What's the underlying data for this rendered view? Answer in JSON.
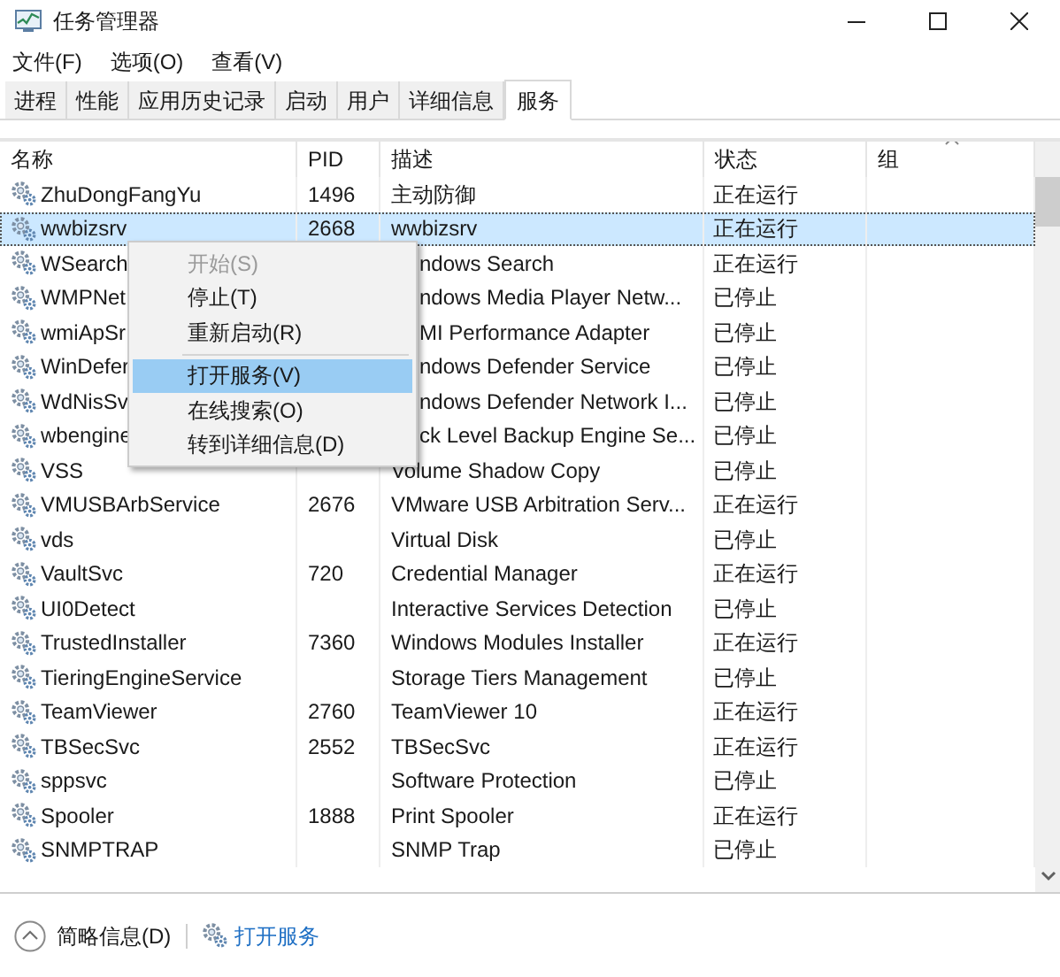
{
  "window": {
    "title": "任务管理器"
  },
  "menu_bar": [
    "文件(F)",
    "选项(O)",
    "查看(V)"
  ],
  "tabs": [
    {
      "label": "进程",
      "selected": false
    },
    {
      "label": "性能",
      "selected": false
    },
    {
      "label": "应用历史记录",
      "selected": false
    },
    {
      "label": "启动",
      "selected": false
    },
    {
      "label": "用户",
      "selected": false
    },
    {
      "label": "详细信息",
      "selected": false
    },
    {
      "label": "服务",
      "selected": true
    }
  ],
  "table": {
    "columns": [
      "名称",
      "PID",
      "描述",
      "状态",
      "组"
    ],
    "rows": [
      {
        "name": "ZhuDongFangYu",
        "pid": "1496",
        "description": "主动防御",
        "status": "正在运行",
        "selected": false
      },
      {
        "name": "wwbizsrv",
        "pid": "2668",
        "description": "wwbizsrv",
        "status": "正在运行",
        "selected": true
      },
      {
        "name": "WSearch",
        "description": "ndows Search",
        "status": "正在运行",
        "selected": false
      },
      {
        "name": "WMPNet",
        "description": "ndows Media Player Netw...",
        "status": "已停止",
        "selected": false
      },
      {
        "name": "wmiApSr",
        "description": "MI Performance Adapter",
        "status": "已停止",
        "selected": false
      },
      {
        "name": "WinDefer",
        "description": "ndows Defender Service",
        "status": "已停止",
        "selected": false
      },
      {
        "name": "WdNisSv",
        "description": "ndows Defender Network I...",
        "status": "已停止",
        "selected": false
      },
      {
        "name": "wbengine",
        "description": "ck Level Backup Engine Se...",
        "status": "已停止",
        "selected": false
      },
      {
        "name": "VSS",
        "description": "Volume Shadow Copy",
        "status": "已停止",
        "selected": false
      },
      {
        "name": "VMUSBArbService",
        "pid": "2676",
        "description": "VMware USB Arbitration Serv...",
        "status": "正在运行",
        "selected": false
      },
      {
        "name": "vds",
        "description": "Virtual Disk",
        "status": "已停止",
        "selected": false
      },
      {
        "name": "VaultSvc",
        "pid": "720",
        "description": "Credential Manager",
        "status": "正在运行",
        "selected": false
      },
      {
        "name": "UI0Detect",
        "description": "Interactive Services Detection",
        "status": "已停止",
        "selected": false
      },
      {
        "name": "TrustedInstaller",
        "pid": "7360",
        "description": "Windows Modules Installer",
        "status": "正在运行",
        "selected": false
      },
      {
        "name": "TieringEngineService",
        "description": "Storage Tiers Management",
        "status": "已停止",
        "selected": false
      },
      {
        "name": "TeamViewer",
        "pid": "2760",
        "description": "TeamViewer 10",
        "status": "正在运行",
        "selected": false
      },
      {
        "name": "TBSecSvc",
        "pid": "2552",
        "description": "TBSecSvc",
        "status": "正在运行",
        "selected": false
      },
      {
        "name": "sppsvc",
        "description": "Software Protection",
        "status": "已停止",
        "selected": false
      },
      {
        "name": "Spooler",
        "pid": "1888",
        "description": "Print Spooler",
        "status": "正在运行",
        "selected": false
      },
      {
        "name": "SNMPTRAP",
        "description": "SNMP Trap",
        "status": "已停止",
        "selected": false
      }
    ]
  },
  "context_menu": {
    "items": [
      {
        "label": "开始(S)",
        "disabled": true,
        "selected": false
      },
      {
        "label": "停止(T)",
        "disabled": false,
        "selected": false
      },
      {
        "label": "重新启动(R)",
        "disabled": false,
        "selected": false,
        "separator_after": true
      },
      {
        "label": "打开服务(V)",
        "disabled": false,
        "selected": true
      },
      {
        "label": "在线搜索(O)",
        "disabled": false,
        "selected": false
      },
      {
        "label": "转到详细信息(D)",
        "disabled": false,
        "selected": false
      }
    ]
  },
  "footer": {
    "toggle": "简略信息(D)",
    "link": "打开服务"
  }
}
